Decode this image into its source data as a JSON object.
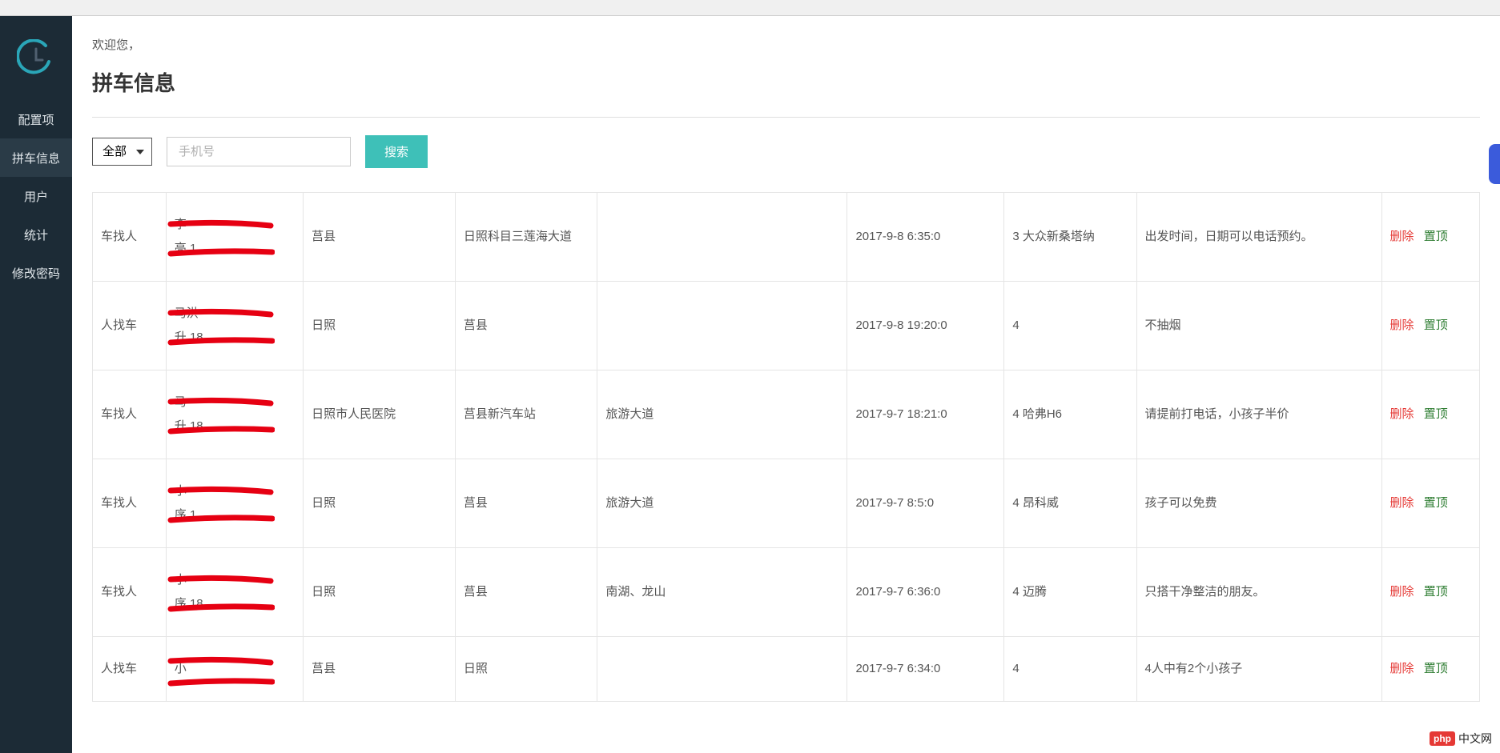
{
  "sidebar": {
    "items": [
      {
        "label": "配置项"
      },
      {
        "label": "拼车信息"
      },
      {
        "label": "用户"
      },
      {
        "label": "统计"
      },
      {
        "label": "修改密码"
      }
    ],
    "active_index": 1
  },
  "header": {
    "welcome": "欢迎您，",
    "title": "拼车信息"
  },
  "filter": {
    "select_value": "全部",
    "phone_placeholder": "手机号",
    "search_label": "搜索"
  },
  "actions": {
    "delete": "删除",
    "top": "置顶"
  },
  "watermark": {
    "php": "php",
    "text": "中文网"
  },
  "rows": [
    {
      "type": "车找人",
      "name_line1": "李",
      "name_line2": "亮 1",
      "start": "莒县",
      "end": "日照科目三莲海大道",
      "via": "",
      "time": "2017-9-8 6:35:0",
      "seats": "3 大众新桑塔纳",
      "remark": "出发时间，日期可以电话预约。"
    },
    {
      "type": "人找车",
      "name_line1": "马洪",
      "name_line2": "升 18",
      "start": "日照",
      "end": "莒县",
      "via": "",
      "time": "2017-9-8 19:20:0",
      "seats": "4",
      "remark": "不抽烟"
    },
    {
      "type": "车找人",
      "name_line1": "马",
      "name_line2": "升 18",
      "start": "日照市人民医院",
      "end": "莒县新汽车站",
      "via": "旅游大道",
      "time": "2017-9-7 18:21:0",
      "seats": "4 哈弗H6",
      "remark": "请提前打电话，小孩子半价"
    },
    {
      "type": "车找人",
      "name_line1": "小",
      "name_line2": "序 1",
      "start": "日照",
      "end": "莒县",
      "via": "旅游大道",
      "time": "2017-9-7 8:5:0",
      "seats": "4 昂科威",
      "remark": "孩子可以免费"
    },
    {
      "type": "车找人",
      "name_line1": "小",
      "name_line2": "序 18",
      "start": "日照",
      "end": "莒县",
      "via": "南湖、龙山",
      "time": "2017-9-7 6:36:0",
      "seats": "4 迈腾",
      "remark": "只搭干净整洁的朋友。"
    },
    {
      "type": "人找车",
      "name_line1": "小",
      "name_line2": "",
      "start": "莒县",
      "end": "日照",
      "via": "",
      "time": "2017-9-7 6:34:0",
      "seats": "4",
      "remark": "4人中有2个小孩子"
    }
  ]
}
